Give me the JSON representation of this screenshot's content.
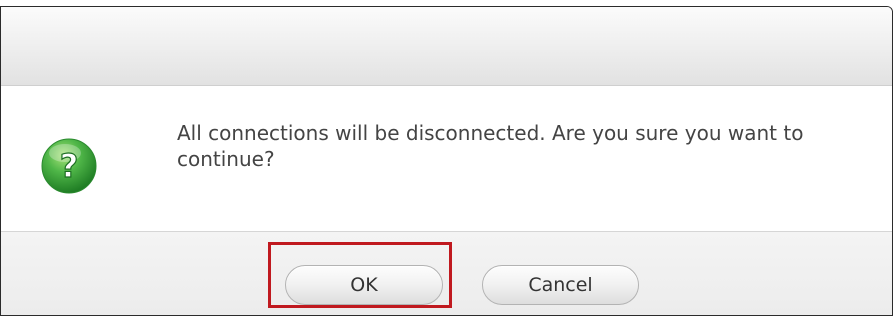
{
  "dialog": {
    "title": "",
    "message": "All connections will be disconnected. Are you sure you want to continue?",
    "icon": "question-icon"
  },
  "buttons": {
    "ok_label": "OK",
    "cancel_label": "Cancel"
  },
  "colors": {
    "icon_green": "#3aa63a",
    "highlight_red": "#c0191f",
    "text": "#444444"
  }
}
